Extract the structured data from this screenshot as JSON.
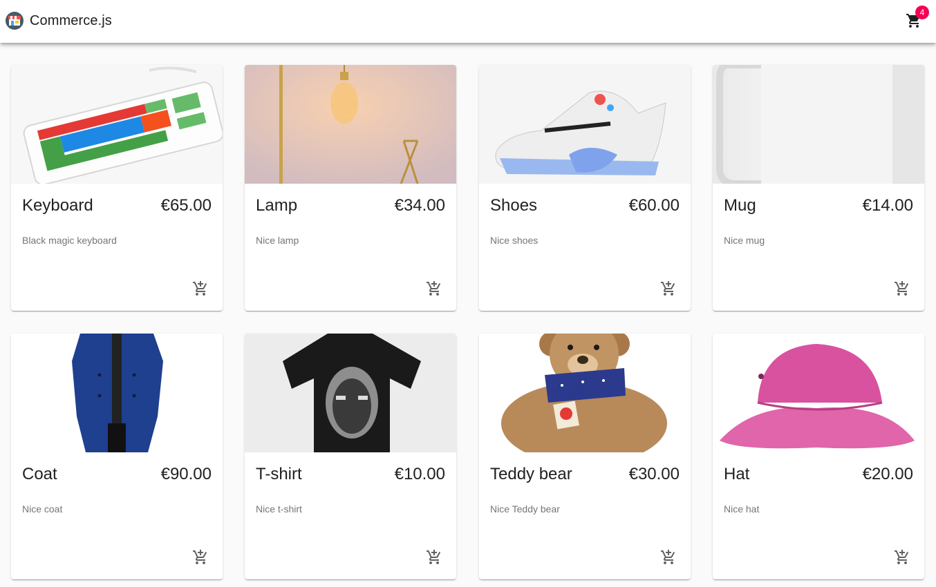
{
  "header": {
    "brand": "Commerce.js",
    "logo_icon": "store-icon",
    "cart_icon": "shopping-cart-icon",
    "cart_count": "4",
    "badge_color": "#f50057"
  },
  "products": [
    {
      "name": "Keyboard",
      "price": "€65.00",
      "description": "Black magic keyboard",
      "image": "keyboard-image"
    },
    {
      "name": "Lamp",
      "price": "€34.00",
      "description": "Nice lamp",
      "image": "lamp-image"
    },
    {
      "name": "Shoes",
      "price": "€60.00",
      "description": "Nice shoes",
      "image": "shoes-image"
    },
    {
      "name": "Mug",
      "price": "€14.00",
      "description": "Nice mug",
      "image": "mug-image"
    },
    {
      "name": "Coat",
      "price": "€90.00",
      "description": "Nice coat",
      "image": "coat-image"
    },
    {
      "name": "T-shirt",
      "price": "€10.00",
      "description": "Nice t-shirt",
      "image": "tshirt-image"
    },
    {
      "name": "Teddy bear",
      "price": "€30.00",
      "description": "Nice Teddy bear",
      "image": "teddy-bear-image"
    },
    {
      "name": "Hat",
      "price": "€20.00",
      "description": "Nice hat",
      "image": "hat-image"
    }
  ],
  "add_to_cart_icon": "add-shopping-cart-icon"
}
